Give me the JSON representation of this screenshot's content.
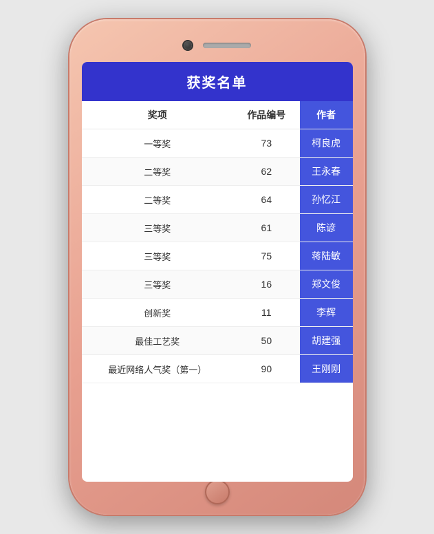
{
  "phone": {
    "title": "获奖名单"
  },
  "table": {
    "header": "获奖名单",
    "columns": {
      "award": "奖项",
      "work_id": "作品编号",
      "author": "作者"
    },
    "rows": [
      {
        "award": "一等奖",
        "work_id": "73",
        "author": "柯良虎"
      },
      {
        "award": "二等奖",
        "work_id": "62",
        "author": "王永春"
      },
      {
        "award": "二等奖",
        "work_id": "64",
        "author": "孙忆江"
      },
      {
        "award": "三等奖",
        "work_id": "61",
        "author": "陈谚"
      },
      {
        "award": "三等奖",
        "work_id": "75",
        "author": "蒋陆敏"
      },
      {
        "award": "三等奖",
        "work_id": "16",
        "author": "郑文俊"
      },
      {
        "award": "创新奖",
        "work_id": "11",
        "author": "李辉"
      },
      {
        "award": "最佳工艺奖",
        "work_id": "50",
        "author": "胡建强"
      },
      {
        "award": "最近网络人气奖（第一）",
        "work_id": "90",
        "author": "王刚刚"
      }
    ]
  }
}
